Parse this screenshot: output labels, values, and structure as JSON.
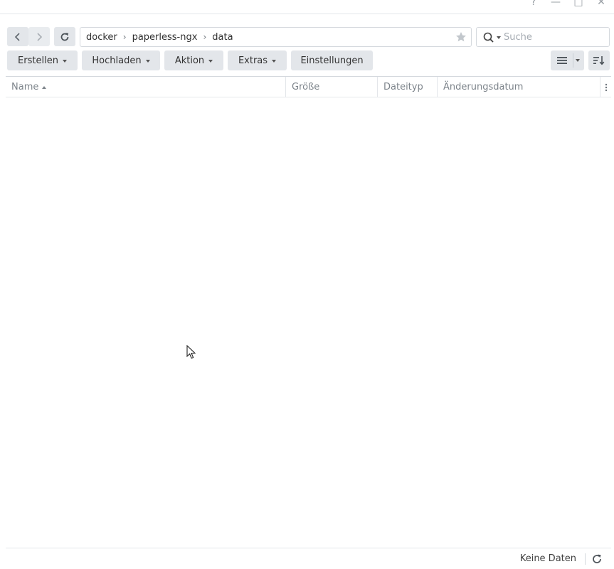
{
  "window": {
    "help_label": "?",
    "minimize_label": "—",
    "maximize_label": "□",
    "close_label": "✕"
  },
  "navigation": {
    "back_icon": "chevron-left-icon",
    "forward_icon": "chevron-right-icon",
    "refresh_icon": "refresh-icon"
  },
  "path": {
    "crumbs": [
      "docker",
      "paperless-ngx",
      "data"
    ],
    "separator": "›",
    "favorite_icon": "star-icon"
  },
  "search": {
    "placeholder": "Suche",
    "value": ""
  },
  "toolbar": {
    "create_label": "Erstellen",
    "upload_label": "Hochladen",
    "action_label": "Aktion",
    "extras_label": "Extras",
    "settings_label": "Einstellungen",
    "view_icon": "list-view-icon",
    "sort_icon": "sort-icon"
  },
  "grid": {
    "columns": [
      "Name",
      "Größe",
      "Dateityp",
      "Änderungsdatum"
    ],
    "sorted_column": "Name",
    "sort_direction": "ascending",
    "rows": []
  },
  "footer": {
    "status": "Keine Daten"
  },
  "colors": {
    "button_bg": "#e3e6ea",
    "border": "#d5d9de",
    "header_text": "#7d848b",
    "text": "#404040"
  }
}
